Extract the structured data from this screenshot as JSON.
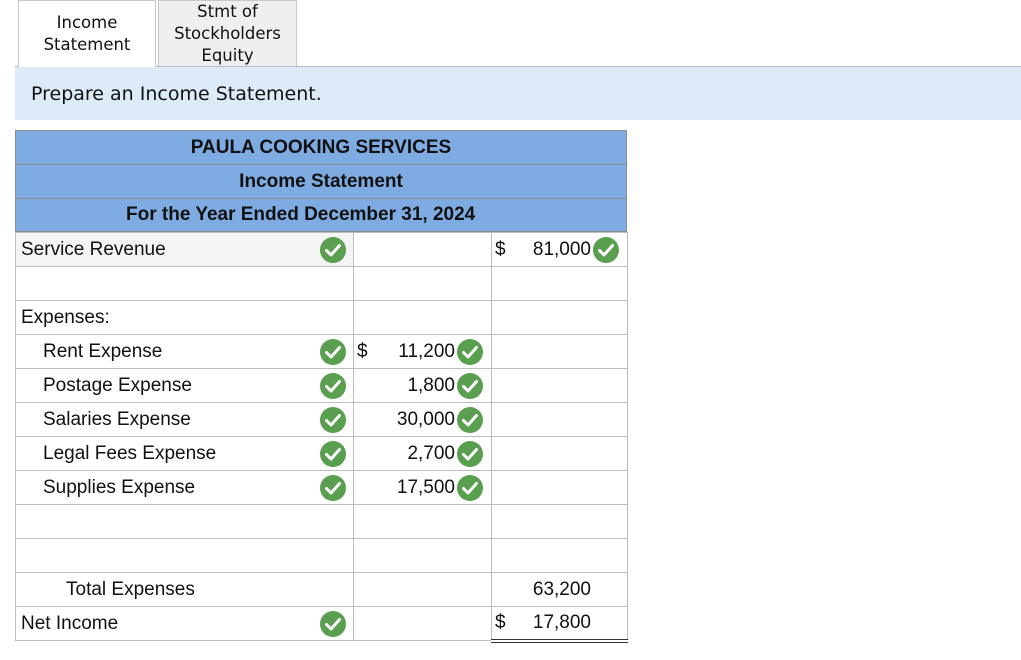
{
  "tabs": [
    {
      "label": "Income\nStatement",
      "active": true
    },
    {
      "label": "Stmt of\nStockholders\nEquity",
      "active": false
    }
  ],
  "instructions": "Prepare an Income Statement.",
  "statement": {
    "company": "PAULA COOKING SERVICES",
    "title": "Income Statement",
    "period": "For the Year Ended December 31, 2024",
    "revenue": {
      "label": "Service Revenue",
      "dollar": "$",
      "amount": "81,000"
    },
    "expenses_heading": "Expenses:",
    "expenses": [
      {
        "label": "Rent Expense",
        "dollar": "$",
        "amount": "11,200"
      },
      {
        "label": "Postage Expense",
        "dollar": "",
        "amount": "1,800"
      },
      {
        "label": "Salaries Expense",
        "dollar": "",
        "amount": "30,000"
      },
      {
        "label": "Legal Fees Expense",
        "dollar": "",
        "amount": "2,700"
      },
      {
        "label": "Supplies Expense",
        "dollar": "",
        "amount": "17,500"
      }
    ],
    "total_expenses": {
      "label": "Total Expenses",
      "amount": "63,200"
    },
    "net_income": {
      "label": "Net Income",
      "dollar": "$",
      "amount": "17,800"
    }
  },
  "colors": {
    "check": "#5a9e4f",
    "header": "#7fabe3",
    "instructions_bg": "#dcebf7"
  },
  "icons": {
    "correct": "check-circle-icon"
  }
}
